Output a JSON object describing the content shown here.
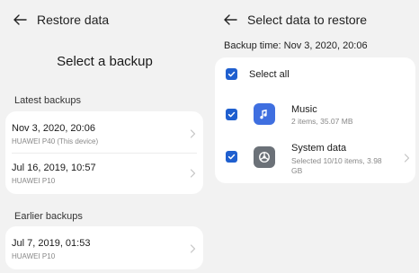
{
  "left": {
    "title": "Restore data",
    "heading": "Select a backup",
    "latest_label": "Latest backups",
    "latest": [
      {
        "date": "Nov 3, 2020, 20:06",
        "device": "HUAWEI P40 (This device)"
      },
      {
        "date": "Jul 16, 2019, 10:57",
        "device": "HUAWEI P10"
      }
    ],
    "earlier_label": "Earlier backups",
    "earlier": [
      {
        "date": "Jul 7, 2019, 01:53",
        "device": "HUAWEI P10"
      }
    ]
  },
  "right": {
    "title": "Select data to restore",
    "backup_time": "Backup time: Nov 3, 2020, 20:06",
    "select_all_label": "Select all",
    "items": [
      {
        "name": "Music",
        "detail": "2 items, 35.07 MB",
        "icon": "music-note-icon",
        "color": "#3f6fe0"
      },
      {
        "name": "System data",
        "detail": "Selected 10/10 items, 3.98 GB",
        "icon": "settings-gear-icon",
        "color": "#6b7178"
      }
    ]
  },
  "colors": {
    "accent": "#1f5fcf",
    "background": "#f2f2f2",
    "card": "#ffffff"
  }
}
